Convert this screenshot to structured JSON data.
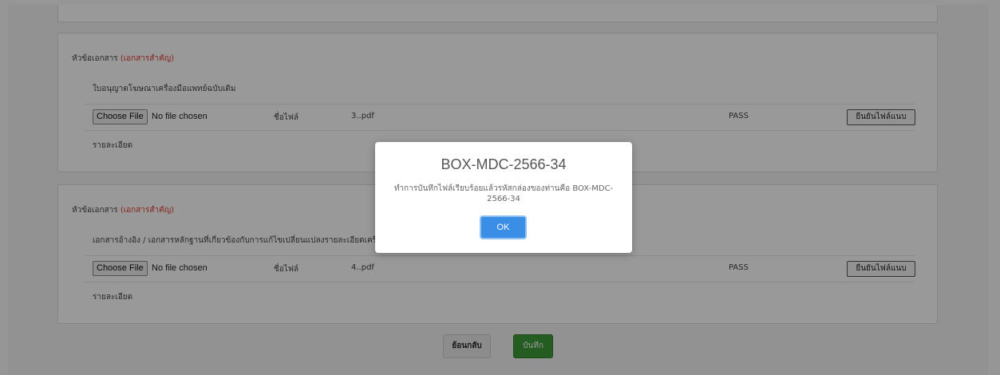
{
  "sections": [
    {
      "heading": "หัวข้อเอกสาร",
      "important_tag": "(เอกสารสำคัญ)",
      "document_name": "ใบอนุญาตโฆษณาเครื่องมือแพทย์ฉบับเดิม",
      "choose_file_label": "Choose File",
      "no_file_text": "No file chosen",
      "file_name_label": "ชื่อไฟล์",
      "file_name_value": "3..pdf",
      "status": "PASS",
      "confirm_label": "ยืนยันไฟล์แนบ",
      "detail_label": "รายละเอียด"
    },
    {
      "heading": "หัวข้อเอกสาร",
      "important_tag": "(เอกสารสำคัญ)",
      "document_name": "เอกสารอ้างอิง / เอกสารหลักฐานที่เกี่ยวข้องกับการแก้ไขเปลี่ยนแปลงรายละเอียดเครื่อ",
      "choose_file_label": "Choose File",
      "no_file_text": "No file chosen",
      "file_name_label": "ชื่อไฟล์",
      "file_name_value": "4..pdf",
      "status": "PASS",
      "confirm_label": "ยืนยันไฟล์แนบ",
      "detail_label": "รายละเอียด"
    }
  ],
  "footer": {
    "back_label": "ย้อนกลับ",
    "save_label": "บันทึก"
  },
  "modal": {
    "title": "BOX-MDC-2566-34",
    "message": "ทำการบันทึกไฟล์เรียบร้อยแล้วรหัสกล่องของท่านคือ BOX-MDC-2566-34",
    "ok_label": "OK"
  },
  "colors": {
    "important": "#e03c31",
    "save_button": "#3d9a3a",
    "ok_button": "#3a8ee6"
  }
}
